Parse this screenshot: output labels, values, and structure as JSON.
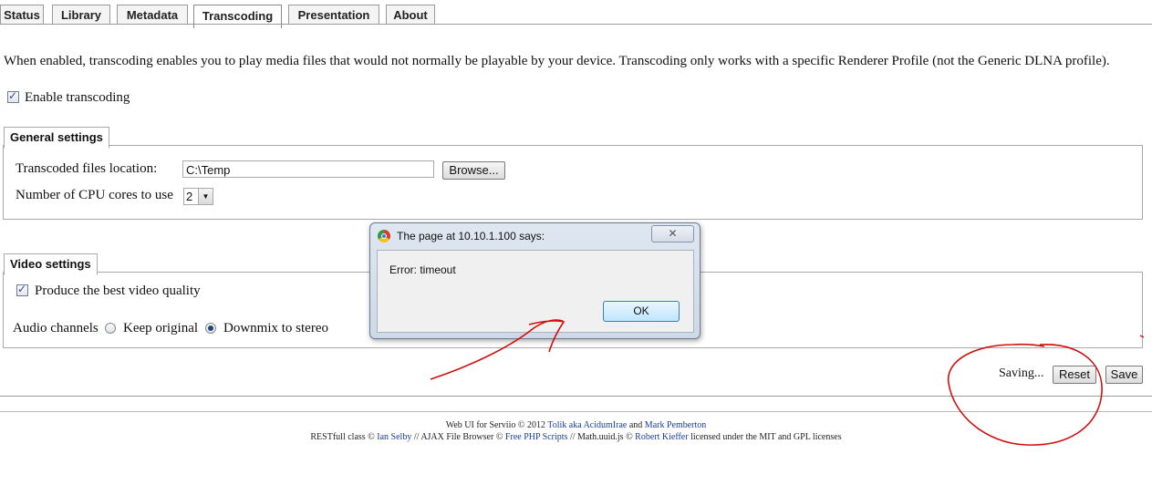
{
  "tabs": [
    {
      "label": "Status"
    },
    {
      "label": "Library"
    },
    {
      "label": "Metadata"
    },
    {
      "label": "Transcoding"
    },
    {
      "label": "Presentation"
    },
    {
      "label": "About"
    }
  ],
  "active_tab": "Transcoding",
  "intro_text": "When enabled, transcoding enables you to play media files that would not normally be playable by your device. Transcoding only works with a specific Renderer Profile (not the Generic DLNA profile).",
  "enable_transcoding": {
    "label": "Enable transcoding",
    "checked": true
  },
  "general": {
    "legend": "General settings",
    "location_label": "Transcoded files location:",
    "location_value": "C:\\Temp",
    "browse_label": "Browse...",
    "cpu_label": "Number of CPU cores to use",
    "cpu_value": "2"
  },
  "video": {
    "legend": "Video settings",
    "best_quality_label": "Produce the best video quality",
    "best_quality_checked": true,
    "audio_label": "Audio channels",
    "audio_options": [
      {
        "label": "Keep original",
        "selected": false
      },
      {
        "label": "Downmix to stereo",
        "selected": true
      }
    ]
  },
  "actions": {
    "saving_text": "Saving...",
    "reset_label": "Reset",
    "save_label": "Save"
  },
  "dialog": {
    "title": "The page at 10.10.1.100 says:",
    "message": "Error: timeout",
    "ok_label": "OK",
    "close_glyph": "✕"
  },
  "footer": {
    "line1_prefix": "Web UI for Serviio © 2012",
    "author1": "Tolik aka AcidumIrae",
    "and": "and",
    "author2": "Mark Pemberton",
    "line2_a": "RESTfull class ©",
    "link_a": "Ian Selby",
    "line2_b": "// AJAX File Browser ©",
    "link_b": "Free PHP Scripts",
    "line2_c": "// Math.uuid.js ©",
    "link_c": "Robert Kieffer",
    "line2_d": "licensed under the MIT and GPL licenses"
  },
  "annotation_color": "#d01010"
}
